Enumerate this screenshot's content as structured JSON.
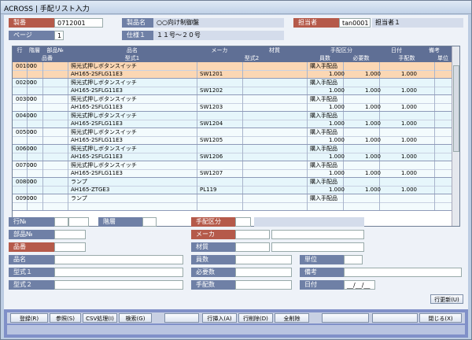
{
  "window": {
    "title": "ACROSS | 手配リスト入力"
  },
  "header": {
    "seiban_label": "製番",
    "seiban_value": "0712001",
    "page_label": "ページ",
    "page_value": "1",
    "seihin_label": "製品名",
    "seihin_value": "○○向け制御盤",
    "shiyou_label": "仕様１",
    "shiyou_value": "１１号～２０号",
    "tantou_label": "担当者",
    "tantou_code": "tan0001",
    "tantou_name": "担当者１"
  },
  "grid": {
    "headers": {
      "gyo": "行",
      "kaiso": "階層",
      "buhin": "部品№",
      "hinmei": "品名",
      "maker": "メーカ",
      "zaishitsu": "材質",
      "tehai": "手配区分",
      "hiduke": "日付",
      "biko": "備考",
      "hinban": "品番",
      "katashiki1": "型式1",
      "katashiki2": "型式2",
      "kosu": "員数",
      "hitsuyo": "必要数",
      "tehaisu": "手配数",
      "tani": "単位"
    },
    "rows": [
      {
        "gyo": "00100",
        "kaiso": "00",
        "hinmei": "照光式押しボタンスイッチ",
        "katashiki1": "AH165-2SFLG11E3",
        "maker": "SW1201",
        "tehai": "購入手配品",
        "kosu": "1.000",
        "hitsuyo": "1.000",
        "tehaisu": "1.000"
      },
      {
        "gyo": "00200",
        "kaiso": "00",
        "hinmei": "照光式押しボタンスイッチ",
        "katashiki1": "AH165-2SFLG11E3",
        "maker": "SW1202",
        "tehai": "購入手配品",
        "kosu": "1.000",
        "hitsuyo": "1.000",
        "tehaisu": "1.000"
      },
      {
        "gyo": "00300",
        "kaiso": "00",
        "hinmei": "照光式押しボタンスイッチ",
        "katashiki1": "AH165-2SFLG11E3",
        "maker": "SW1203",
        "tehai": "購入手配品",
        "kosu": "1.000",
        "hitsuyo": "1.000",
        "tehaisu": "1.000"
      },
      {
        "gyo": "00400",
        "kaiso": "00",
        "hinmei": "照光式押しボタンスイッチ",
        "katashiki1": "AH165-2SFLG11E3",
        "maker": "SW1204",
        "tehai": "購入手配品",
        "kosu": "1.000",
        "hitsuyo": "1.000",
        "tehaisu": "1.000"
      },
      {
        "gyo": "00500",
        "kaiso": "00",
        "hinmei": "照光式押しボタンスイッチ",
        "katashiki1": "AH165-2SFLG11E3",
        "maker": "SW1205",
        "tehai": "購入手配品",
        "kosu": "1.000",
        "hitsuyo": "1.000",
        "tehaisu": "1.000"
      },
      {
        "gyo": "00600",
        "kaiso": "00",
        "hinmei": "照光式押しボタンスイッチ",
        "katashiki1": "AH165-2SFLG11E3",
        "maker": "SW1206",
        "tehai": "購入手配品",
        "kosu": "1.000",
        "hitsuyo": "1.000",
        "tehaisu": "1.000"
      },
      {
        "gyo": "00700",
        "kaiso": "00",
        "hinmei": "照光式押しボタンスイッチ",
        "katashiki1": "AH165-2SFLG11E3",
        "maker": "SW1207",
        "tehai": "購入手配品",
        "kosu": "1.000",
        "hitsuyo": "1.000",
        "tehaisu": "1.000"
      },
      {
        "gyo": "00800",
        "kaiso": "00",
        "hinmei": "ランプ",
        "katashiki1": "AH165-ZTGE3",
        "maker": "PL119",
        "tehai": "購入手配品",
        "kosu": "1.000",
        "hitsuyo": "1.000",
        "tehaisu": "1.000"
      },
      {
        "gyo": "00900",
        "kaiso": "00",
        "hinmei": "ランプ",
        "katashiki1": "",
        "maker": "",
        "tehai": "購入手配品",
        "kosu": "",
        "hitsuyo": "",
        "tehaisu": ""
      }
    ]
  },
  "form": {
    "gyo_label": "行№",
    "kaiso_label": "階層",
    "tehai_label": "手配区分",
    "buhin_label": "部品№",
    "maker_label": "メーカ",
    "hinban_label": "品番",
    "zaishitsu_label": "材質",
    "hinmei_label": "品名",
    "kosu_label": "員数",
    "tani_label": "単位",
    "kata1_label": "型式１",
    "hitsuyo_label": "必要数",
    "biko_label": "備考",
    "kata2_label": "型式２",
    "tehaisu_label": "手配数",
    "hiduke_label": "日付",
    "date_value": "__/__/__",
    "update_btn": "行更新(U)"
  },
  "buttons": {
    "b1": "登録(R)",
    "b2": "参照(S)",
    "b3": "CSV処理(I)",
    "b4": "検索(G)",
    "b5": "",
    "b6": "行挿入(A)",
    "b7": "行削除(D)",
    "b8": "全削除",
    "b9": "",
    "b10": "",
    "b11": "閉じる(X)"
  }
}
